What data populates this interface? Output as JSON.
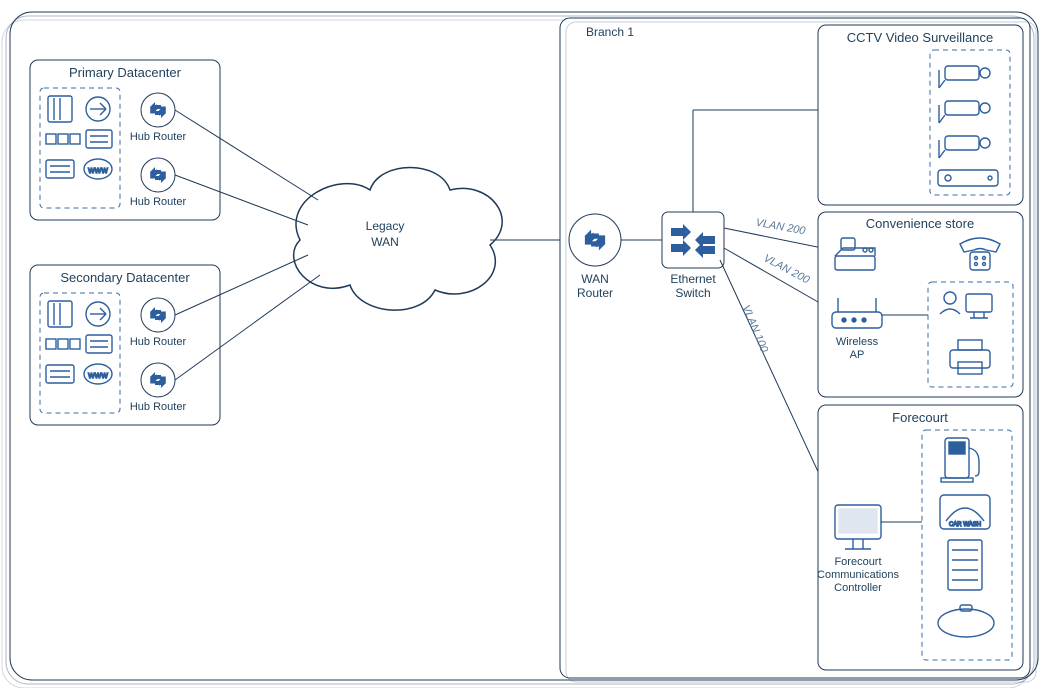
{
  "datacenters": {
    "primary": {
      "title": "Primary Datacenter",
      "hub1": "Hub Router",
      "hub2": "Hub Router"
    },
    "secondary": {
      "title": "Secondary Datacenter",
      "hub1": "Hub Router",
      "hub2": "Hub Router"
    }
  },
  "wan": {
    "legacy": "Legacy",
    "legacy2": "WAN"
  },
  "branch": {
    "title": "Branch 1",
    "wan_router": "WAN",
    "wan_router2": "Router",
    "switch": "Ethernet",
    "switch2": "Switch",
    "vlan200a": "VLAN 200",
    "vlan200b": "VLAN 200",
    "vlan100": "VLAN 100"
  },
  "cctv": {
    "title": "CCTV Video Surveillance"
  },
  "store": {
    "title": "Convenience store",
    "ap": "Wireless",
    "ap2": "AP"
  },
  "forecourt": {
    "title": "Forecourt",
    "fcc1": "Forecourt",
    "fcc2": "Communications",
    "fcc3": "Controller",
    "carwash": "CAR WASH"
  }
}
